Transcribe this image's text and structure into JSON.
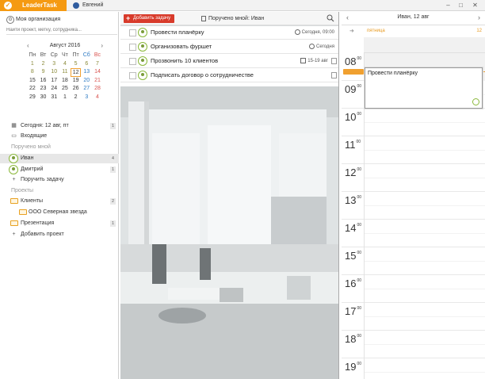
{
  "window": {
    "app_name": "LeaderTask",
    "user_tab": "Евгений",
    "buttons": {
      "minimize": "–",
      "maximize": "□",
      "close": "✕"
    }
  },
  "sidebar": {
    "org_name": "Моя организация",
    "search_placeholder": "Найти проект, метку, сотрудника...",
    "calendar": {
      "month_label": "Август 2016",
      "weekdays": [
        "Пн",
        "Вт",
        "Ср",
        "Чт",
        "Пт",
        "Сб",
        "Вс"
      ],
      "weeks": [
        [
          "1",
          "2",
          "3",
          "4",
          "5",
          "6",
          "7"
        ],
        [
          "8",
          "9",
          "10",
          "11",
          "12",
          "13",
          "14"
        ],
        [
          "15",
          "16",
          "17",
          "18",
          "19",
          "20",
          "21"
        ],
        [
          "22",
          "23",
          "24",
          "25",
          "26",
          "27",
          "28"
        ],
        [
          "29",
          "30",
          "31",
          "1",
          "2",
          "3",
          "4"
        ]
      ],
      "today": "12"
    },
    "today_item": {
      "label": "Сегодня: 12 авг, пт",
      "count": "1"
    },
    "inbox_item": {
      "label": "Входящие"
    },
    "assigned_section": "Поручено мной",
    "people": [
      {
        "name": "Иван",
        "count": "4"
      },
      {
        "name": "Дмитрий",
        "count": "1"
      }
    ],
    "assign_task": "Поручить задачу",
    "projects_section": "Проекты",
    "projects": [
      {
        "name": "Клиенты",
        "count": "2"
      },
      {
        "name": "ООО Северная звезда"
      },
      {
        "name": "Презентация",
        "count": "1"
      }
    ],
    "add_project": "Добавить проект"
  },
  "middle": {
    "add_task_label": "Добавить задачу",
    "view_title": "Поручено мной: Иван",
    "tasks": [
      {
        "title": "Провести планёрку",
        "due": "Сегодня, 09:00",
        "due_icon": "clock-icon"
      },
      {
        "title": "Организовать фуршет",
        "due": "Сегодня",
        "due_icon": "clock-icon"
      },
      {
        "title": "Прозвонить 10 клиентов",
        "due": "15-19 авг",
        "due_icon": "calendar-icon"
      },
      {
        "title": "Подписать договор о сотрудничестве",
        "due": ""
      }
    ]
  },
  "dayview": {
    "title": "Иван, 12 авг",
    "weekday": "пятница",
    "day_number": "12",
    "hours": [
      "08",
      "09",
      "10",
      "11",
      "12",
      "13",
      "14",
      "15",
      "16",
      "17",
      "18",
      "19"
    ],
    "minutes": "00",
    "event_title": "Провести планёрку"
  },
  "colors": {
    "accent": "#f59a12",
    "add_button": "#d83b2b",
    "avatar_ring": "#8ab83a"
  }
}
